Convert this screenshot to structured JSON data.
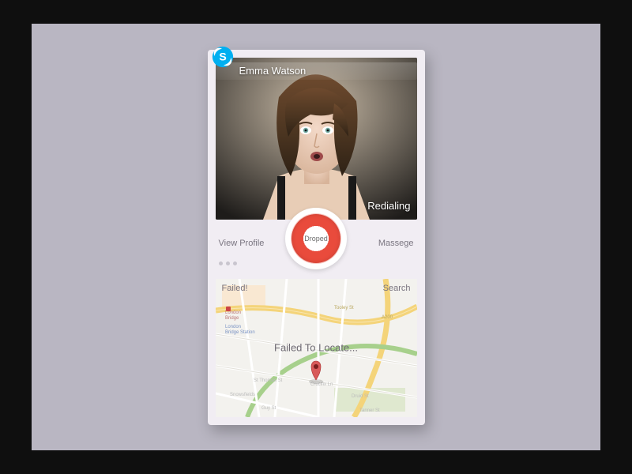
{
  "contact": {
    "name": "Emma Watson",
    "status": "Redialing"
  },
  "call_button": {
    "label": "Droped"
  },
  "actions": {
    "view_profile": "View Profile",
    "message": "Massege"
  },
  "map": {
    "status": "Failed!",
    "search_label": "Search",
    "overlay": "Failed To Locate..."
  },
  "icons": {
    "app": "skype-icon"
  },
  "colors": {
    "accent_red": "#e94b3c",
    "card_bg": "#f1edf3",
    "stage_bg": "#b9b6c2"
  }
}
